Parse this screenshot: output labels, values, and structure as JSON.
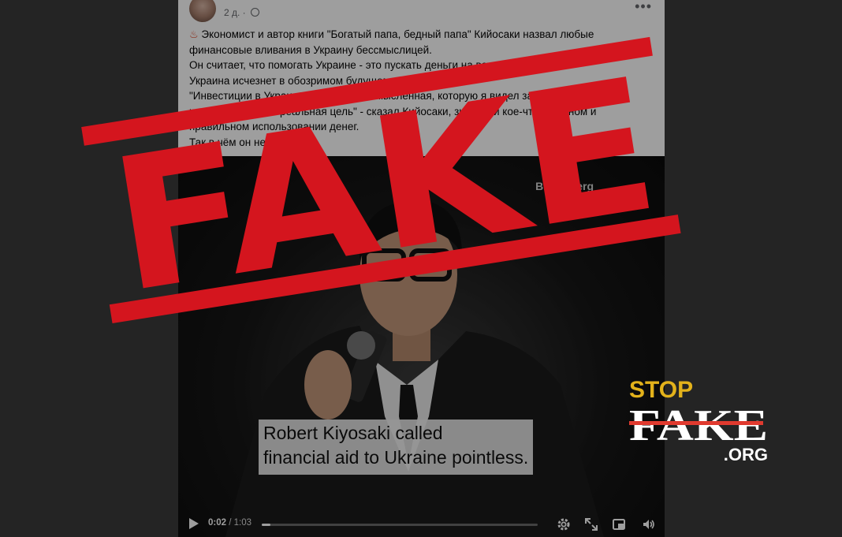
{
  "post": {
    "time": "2 д.",
    "more": "•••",
    "lines": [
      "Экономист и автор книги \"Богатый папа, бедный папа\" Кийосаки назвал любые",
      "финансовые вливания в Украину бессмыслицей.",
      "Он считает, что помогать Украине - это пускать деньги на ветер, потому что",
      "Украина исчезнет в обозримом будущем.",
      "\"Инвестиции в Украину — самая бессмысленная, которую я видел за всю свою жизнь,",
      "какая бы ни была реальная цель\" - сказал Кийосаки, знающий кое-что о личном и",
      "правильном использовании денег.",
      "Так в чём он не прав?"
    ]
  },
  "video": {
    "watermark": "Bloomberg",
    "caption_line1": "Robert Kiyosaki called",
    "caption_line2": "financial aid to Ukraine pointless.",
    "current_time": "0:02",
    "duration": "/ 1:03",
    "progress": 0.03
  },
  "stamp": {
    "text": "FAKE",
    "color": "#d4151e"
  },
  "logo": {
    "top": "STOP",
    "middle": "FAKE",
    "bottom": ".ORG",
    "accent": "#e3b21b",
    "strike": "#e03a2f"
  },
  "icons": [
    "hot-springs-icon",
    "globe-icon",
    "more-icon",
    "play-icon",
    "settings-icon",
    "fullscreen-icon",
    "pip-icon",
    "volume-icon"
  ]
}
